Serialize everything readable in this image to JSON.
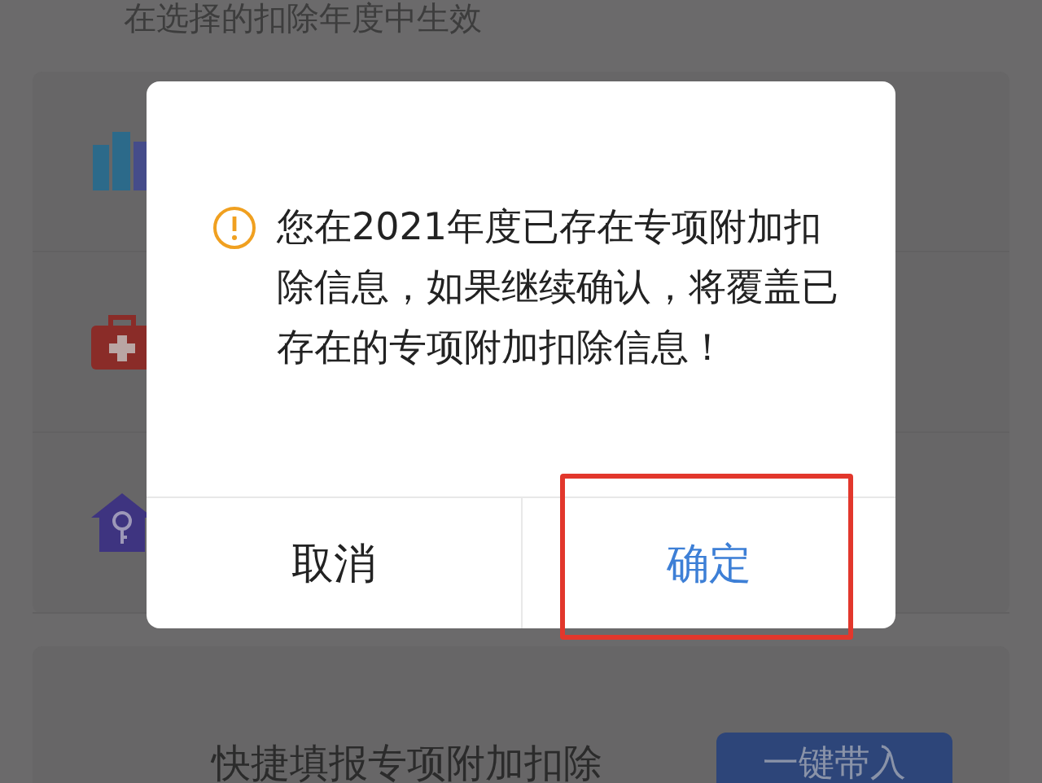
{
  "page": {
    "hint": "在选择的扣除年度中生效",
    "items": [
      {
        "kind": "books"
      },
      {
        "kind": "medical"
      },
      {
        "kind": "house"
      }
    ],
    "quick_fill": {
      "label": "快捷填报专项附加扣除",
      "button": "一键带入"
    }
  },
  "dialog": {
    "message": "您在2021年度已存在专项附加扣除信息，如果继续确认，将覆盖已存在的专项附加扣除信息！",
    "buttons": [
      {
        "label": "取消",
        "kind": "cancel",
        "highlighted": false
      },
      {
        "label": "确定",
        "kind": "confirm",
        "highlighted": true
      }
    ]
  }
}
